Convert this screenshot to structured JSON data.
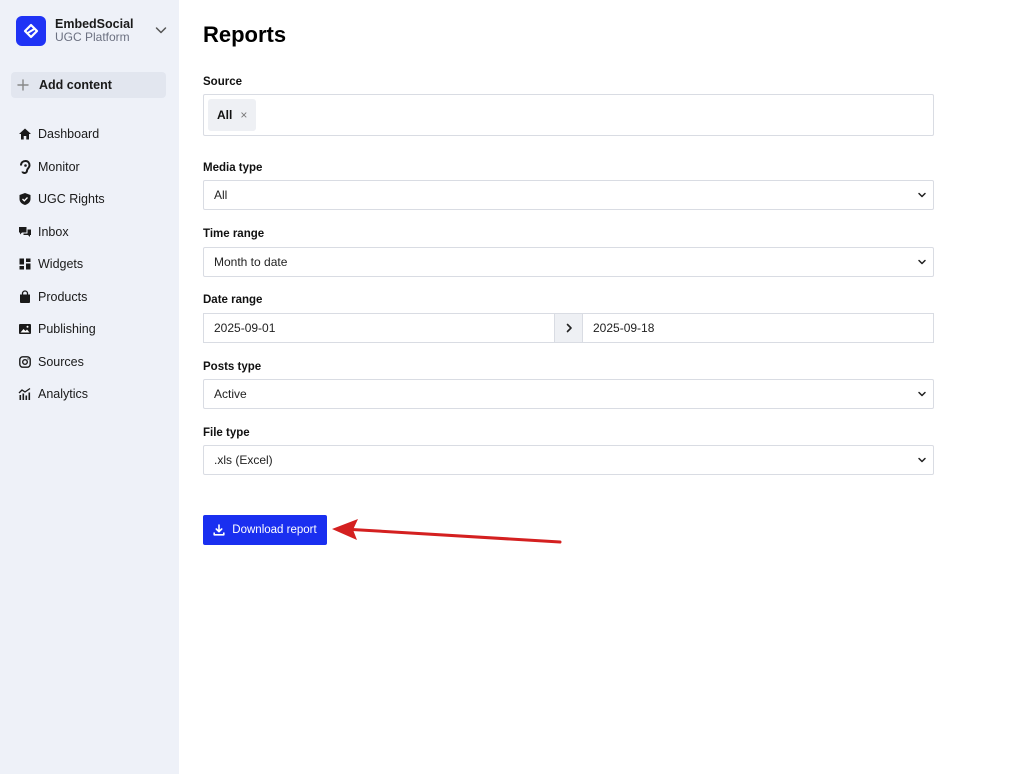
{
  "brand": {
    "name": "EmbedSocial",
    "subtitle": "UGC Platform",
    "logo_icon": "embedsocial-logo-icon",
    "accent_color": "#1f33f5"
  },
  "sidebar": {
    "add_content_label": "Add content",
    "items": [
      {
        "label": "Dashboard",
        "icon": "home-icon"
      },
      {
        "label": "Monitor",
        "icon": "ear-icon"
      },
      {
        "label": "UGC Rights",
        "icon": "shield-icon"
      },
      {
        "label": "Inbox",
        "icon": "chat-bubbles-icon"
      },
      {
        "label": "Widgets",
        "icon": "widgets-grid-icon"
      },
      {
        "label": "Products",
        "icon": "shopping-bag-icon"
      },
      {
        "label": "Publishing",
        "icon": "image-icon"
      },
      {
        "label": "Sources",
        "icon": "instagram-icon"
      },
      {
        "label": "Analytics",
        "icon": "analytics-chart-icon"
      }
    ]
  },
  "page": {
    "title": "Reports"
  },
  "form": {
    "source": {
      "label": "Source",
      "tag": "All",
      "remove_glyph": "×"
    },
    "media_type": {
      "label": "Media type",
      "value": "All"
    },
    "time_range": {
      "label": "Time range",
      "value": "Month to date"
    },
    "date_range": {
      "label": "Date range",
      "start": "2025-09-01",
      "end": "2025-09-18"
    },
    "posts_type": {
      "label": "Posts type",
      "value": "Active"
    },
    "file_type": {
      "label": "File type",
      "value": ".xls (Excel)"
    },
    "download_label": "Download report",
    "button_color": "#1a2ff0"
  },
  "annotation": {
    "arrow_color": "#d42020"
  }
}
